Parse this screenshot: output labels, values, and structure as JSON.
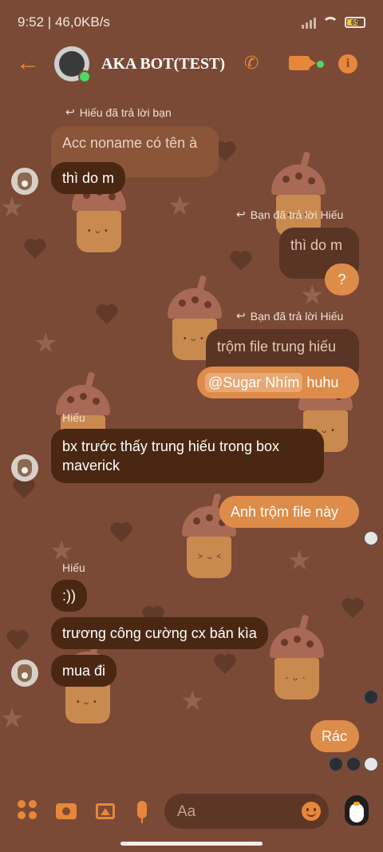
{
  "status": {
    "time": "9:52 | 46,0KB/s",
    "battery": "65"
  },
  "header": {
    "title": "AKA BOT(TEST)"
  },
  "messages": {
    "reply_note_1": "Hiếu đã trả lời bạn",
    "quoted_1": "Acc noname có tên à",
    "msg_1": "thì do m",
    "reply_note_2": "Bạn đã trả lời Hiếu",
    "quoted_2": "thì do m",
    "msg_2": "?",
    "reply_note_3": "Bạn đã trả lời Hiếu",
    "quoted_3": "trộm file trung hiếu",
    "mention": "@Sugar Nhím",
    "msg_3_tail": "huhu",
    "sender_1": "Hiếu",
    "msg_4": "bx trước thấy trung hiếu trong box maverick",
    "msg_5": "Anh trộm file này",
    "sender_2": "Hiếu",
    "msg_6": ":))",
    "msg_7": "trương công cường cx bán kìa",
    "msg_8": "mua đi",
    "msg_9": "Rác"
  },
  "composer": {
    "placeholder": "Aa"
  },
  "colors": {
    "background": "#7a4a36",
    "accent": "#e8873a",
    "incoming_bubble": "#4a2712",
    "outgoing_bubble": "#de8c49"
  }
}
